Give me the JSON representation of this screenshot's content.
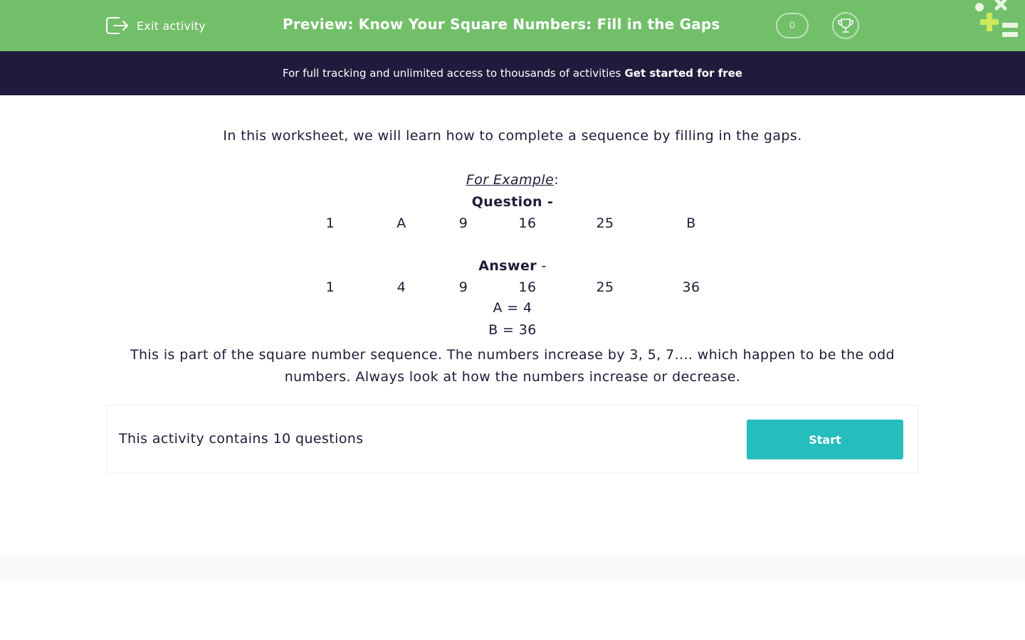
{
  "header": {
    "exit_label": "Exit activity",
    "title": "Preview: Know Your Square Numbers: Fill in the Gaps",
    "score": "0",
    "icons": [
      "exit-icon",
      "trophy-icon",
      "logo-icon"
    ],
    "colors": {
      "header_bg": "#72bf6a",
      "logo_plus": "#cde85a",
      "logo_shapes": "#e8f6df"
    }
  },
  "banner": {
    "text": "For full tracking and unlimited access to thousands of activities",
    "link": "Get started for free",
    "bg": "#221a3c"
  },
  "content": {
    "intro": "In this worksheet, we will learn how to complete a sequence by filling in the gaps.",
    "example_label": "For Example",
    "example_colon": ":",
    "question_heading": "Question -",
    "question_sequence": [
      "1",
      "A",
      "9",
      "16",
      "25",
      "B"
    ],
    "answer_heading": "Answer",
    "answer_dash": " -",
    "answer_sequence": [
      "1",
      "4",
      "9",
      "16",
      "25",
      "36"
    ],
    "answer_a": "A = 4",
    "answer_b": "B = 36",
    "explanation": "This is part of the square number sequence.  The numbers increase by 3, 5, 7.... which happen to be the odd numbers.  Always look at how the numbers increase or decrease."
  },
  "activity": {
    "summary": "This activity contains 10 questions",
    "start_label": "Start",
    "button_color": "#25bdbd"
  }
}
